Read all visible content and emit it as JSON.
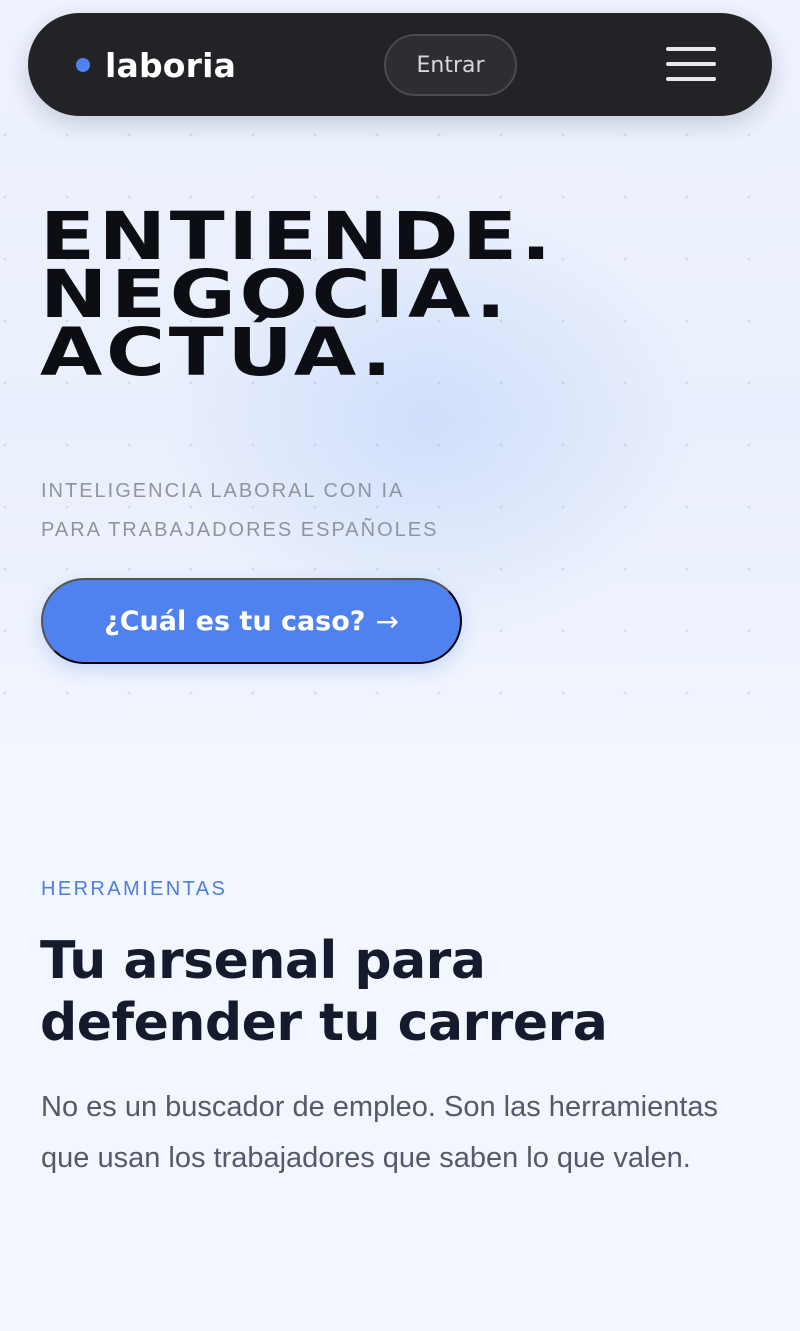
{
  "navbar": {
    "brand": "laboria",
    "login_label": "Entrar",
    "menu_icon": "hamburger-menu-icon",
    "brand_dot_icon": "brand-dot-icon"
  },
  "hero": {
    "headline": [
      "ENTIENDE.",
      "NEGOCIA.",
      "ACTÚA."
    ],
    "tagline": [
      "INTELIGENCIA LABORAL CON IA",
      "PARA TRABAJADORES ESPAÑOLES"
    ],
    "cta_label": "¿Cuál es tu caso?",
    "cta_arrow": "→"
  },
  "tools": {
    "eyebrow": "HERRAMIENTAS",
    "title": [
      "Tu arsenal para",
      "defender tu carrera"
    ],
    "description": "No es un buscador de empleo. Son las herramientas que usan los trabajadores que saben lo que valen."
  },
  "colors": {
    "accent": "#4f82ef",
    "navbar_bg": "#222326",
    "page_bg": "#f2f6fe",
    "headline": "#0c0e14",
    "eyebrow": "#4f7fdc"
  }
}
